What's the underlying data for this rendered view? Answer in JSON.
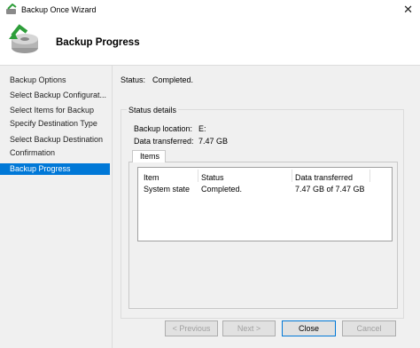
{
  "window": {
    "title": "Backup Once Wizard",
    "close_glyph": "✕"
  },
  "header": {
    "title": "Backup Progress",
    "icon": "backup-drive-icon"
  },
  "nav": {
    "items": [
      {
        "label": "Backup Options"
      },
      {
        "label": "Select Backup Configurat..."
      },
      {
        "label": "Select Items for Backup"
      },
      {
        "label": "Specify Destination Type"
      },
      {
        "label": "Select Backup Destination"
      },
      {
        "label": "Confirmation"
      },
      {
        "label": "Backup Progress",
        "active": true
      }
    ]
  },
  "status": {
    "label": "Status:",
    "value": "Completed."
  },
  "details": {
    "group_title": "Status details",
    "backup_location_label": "Backup location:",
    "backup_location_value": "E:",
    "data_transferred_label": "Data transferred:",
    "data_transferred_value": "7.47 GB",
    "tab_label": "Items",
    "table": {
      "columns": [
        "Item",
        "Status",
        "Data transferred"
      ],
      "rows": [
        {
          "item": "System state",
          "status": "Completed.",
          "data": "7.47 GB of 7.47 GB"
        }
      ]
    }
  },
  "buttons": {
    "previous": "< Previous",
    "next": "Next >",
    "close": "Close",
    "cancel": "Cancel"
  },
  "colors": {
    "accent": "#0078d7"
  }
}
